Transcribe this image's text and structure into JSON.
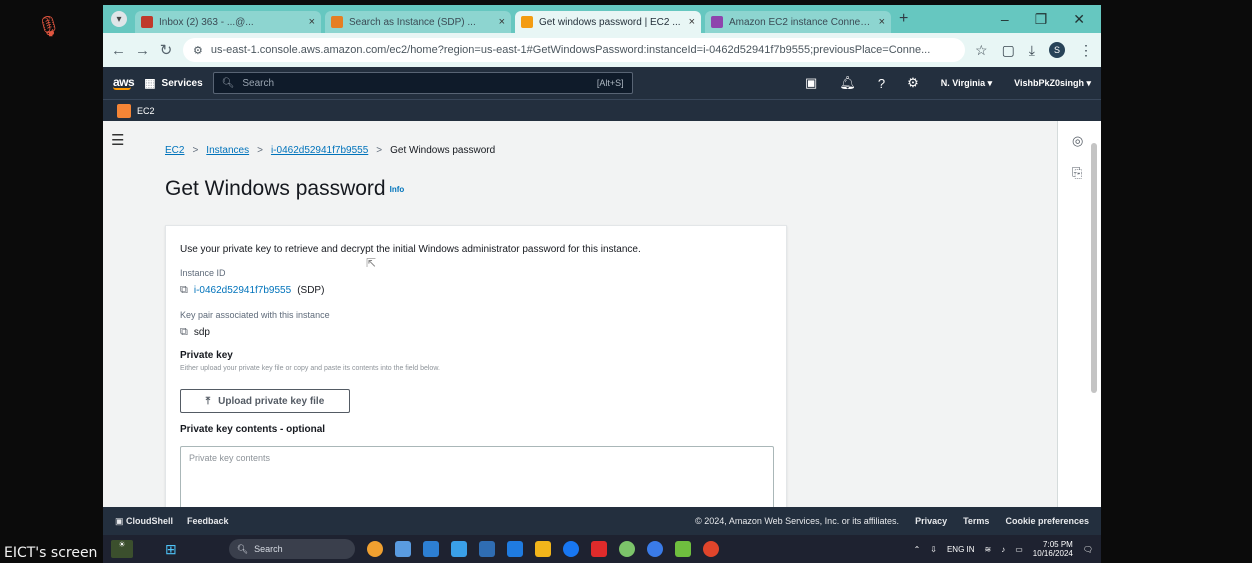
{
  "presenter": {
    "label": "EICT's screen"
  },
  "browser": {
    "tabs": [
      {
        "label": "Inbox (2) 363 - ...@...",
        "color": "#c0392b",
        "active": false
      },
      {
        "label": "Search as Instance (SDP) ...",
        "color": "#e67e22",
        "active": false
      },
      {
        "label": "Get windows password | EC2 ...",
        "color": "#f39c12",
        "active": true
      },
      {
        "label": "Amazon EC2 instance Connec...",
        "color": "#8e44ad",
        "active": false
      }
    ],
    "url": "us-east-1.console.aws.amazon.com/ec2/home?region=us-east-1#GetWindowsPassword:instanceId=i-0462d52941f7b9555;previousPlace=Conne..."
  },
  "aws_nav": {
    "logo": "aws",
    "services_label": "Services",
    "search_placeholder": "Search",
    "search_shortcut": "[Alt+S]",
    "region": "N. Virginia ▾",
    "account": "VishbPkZ0singh ▾",
    "service_crumb": "EC2"
  },
  "breadcrumbs": {
    "ec2": "EC2",
    "instances": "Instances",
    "instance_id": "i-0462d52941f7b9555",
    "current": "Get Windows password"
  },
  "page": {
    "title": "Get Windows password",
    "info": "Info",
    "description": "Use your private key to retrieve and decrypt the initial Windows administrator password for this instance.",
    "instance_id_label": "Instance ID",
    "instance_id_value": "i-0462d52941f7b9555",
    "instance_name": "(SDP)",
    "key_pair_label": "Key pair associated with this instance",
    "key_pair_value": "sdp",
    "private_key_label": "Private key",
    "private_key_hint": "Either upload your private key file or copy and paste its contents into the field below.",
    "upload_button": "Upload private key file",
    "contents_label": "Private key contents - optional",
    "contents_placeholder": "Private key contents"
  },
  "aws_footer": {
    "cloudshell": "CloudShell",
    "feedback": "Feedback",
    "copyright": "© 2024, Amazon Web Services, Inc. or its affiliates.",
    "privacy": "Privacy",
    "terms": "Terms",
    "cookie": "Cookie preferences"
  },
  "taskbar": {
    "search": "Search",
    "lang": "ENG IN",
    "time": "7:05 PM",
    "date": "10/16/2024"
  }
}
